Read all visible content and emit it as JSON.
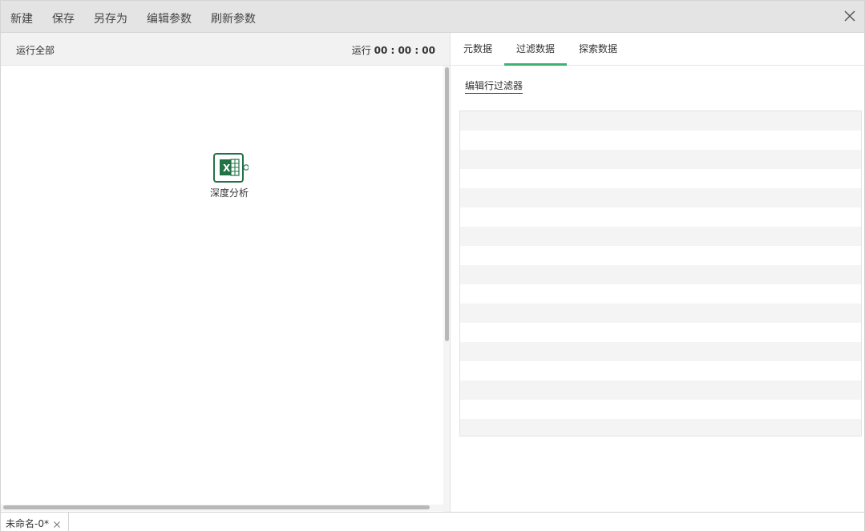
{
  "menu": {
    "new": "新建",
    "save": "保存",
    "save_as": "另存为",
    "edit_params": "编辑参数",
    "refresh_params": "刷新参数"
  },
  "left_panel": {
    "run_all": "运行全部",
    "timer_label": "运行",
    "timer_value": "00 : 00 : 00",
    "node": {
      "label": "深度分析",
      "icon": "excel-icon"
    }
  },
  "right_panel": {
    "tabs": [
      "元数据",
      "过滤数据",
      "探索数据"
    ],
    "active_tab": "过滤数据",
    "edit_row_filter": "编辑行过滤器",
    "table_rows": 17
  },
  "bottom": {
    "doc_tab_label": "未命名-0*"
  },
  "colors": {
    "accent": "#3cb371",
    "menubar_bg": "#e4e4e4",
    "excel_green": "#217346"
  }
}
